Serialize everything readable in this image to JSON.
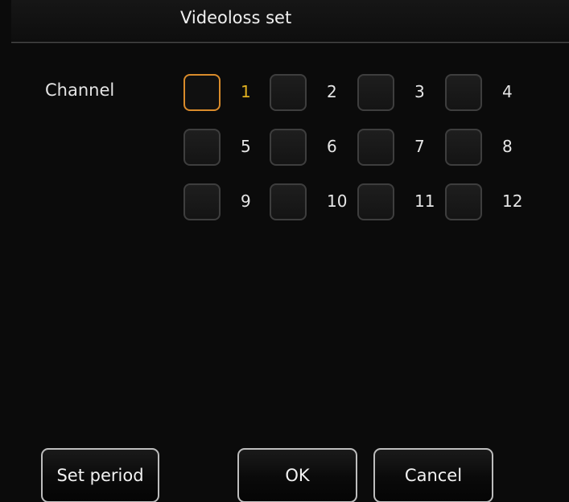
{
  "dialog": {
    "title": "Videoloss set"
  },
  "channel": {
    "label": "Channel",
    "items": [
      {
        "number": "1",
        "checked": false,
        "focused": true
      },
      {
        "number": "2",
        "checked": false,
        "focused": false
      },
      {
        "number": "3",
        "checked": false,
        "focused": false
      },
      {
        "number": "4",
        "checked": false,
        "focused": false
      },
      {
        "number": "5",
        "checked": false,
        "focused": false
      },
      {
        "number": "6",
        "checked": false,
        "focused": false
      },
      {
        "number": "7",
        "checked": false,
        "focused": false
      },
      {
        "number": "8",
        "checked": false,
        "focused": false
      },
      {
        "number": "9",
        "checked": false,
        "focused": false
      },
      {
        "number": "10",
        "checked": false,
        "focused": false
      },
      {
        "number": "11",
        "checked": false,
        "focused": false
      },
      {
        "number": "12",
        "checked": false,
        "focused": false
      }
    ]
  },
  "buttons": {
    "set_period": "Set period",
    "ok": "OK",
    "cancel": "Cancel"
  },
  "colors": {
    "background": "#0b0b0b",
    "focus_border": "#d98b2b",
    "focus_text": "#e0b020",
    "checkbox_border": "#3e3e3e",
    "button_border": "#bdbdbd"
  }
}
